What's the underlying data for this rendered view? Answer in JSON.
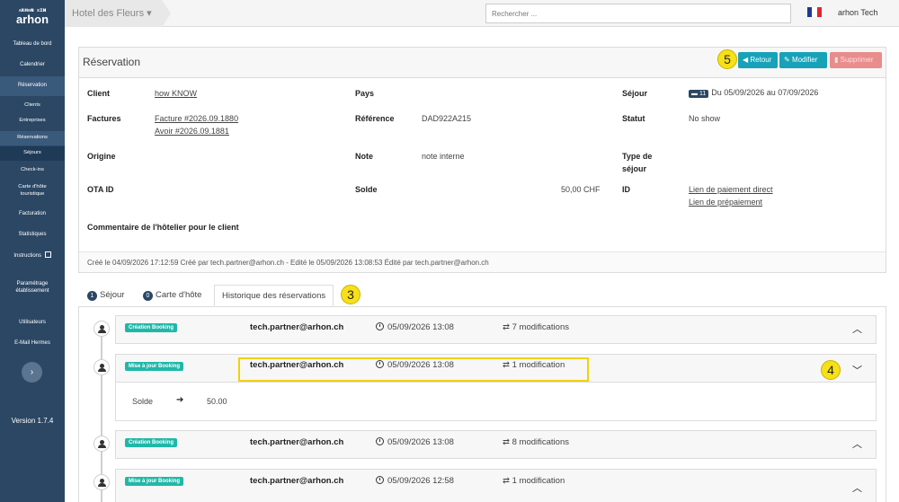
{
  "app": {
    "logo_top": "ᴀʀʜᴏɴ ᴇɪɴ",
    "logo_word": "arhon",
    "version": "Version 1.7.4"
  },
  "sidebar": {
    "items": [
      {
        "label": "Tableau de bord"
      },
      {
        "label": "Calendrier"
      },
      {
        "label": "Réservation"
      },
      {
        "label": "Clients"
      },
      {
        "label": "Entreprises"
      },
      {
        "label": "Réservations"
      },
      {
        "label": "Séjours"
      },
      {
        "label": "Check-ins"
      },
      {
        "label": "Carte d'hôte touristique"
      },
      {
        "label": "Facturation"
      },
      {
        "label": "Statistiques"
      },
      {
        "label": "Instructions"
      },
      {
        "label": "Paramétrage établissement"
      },
      {
        "label": "Utilisateurs"
      },
      {
        "label": "E-Mail Hermes"
      }
    ],
    "collapse_icon": "chevron-right-icon"
  },
  "topbar": {
    "hotel": "Hotel des Fleurs",
    "search_placeholder": "Rechercher ...",
    "user": "arhon Tech",
    "flag_colors": [
      "#1d3a8f",
      "#ffffff",
      "#e0262f"
    ]
  },
  "reservation": {
    "title": "Réservation",
    "buttons": {
      "retour": "Retour",
      "modifier": "Modifier",
      "supprimer": "Supprimer"
    },
    "fields": {
      "client_label": "Client",
      "client_value": "how KNOW",
      "factures_label": "Factures",
      "facture_1": "Facture #2026.09.1880",
      "facture_2": "Avoir #2026.09.1881",
      "origine_label": "Origine",
      "ota_label": "OTA ID",
      "pays_label": "Pays",
      "reference_label": "Référence",
      "reference_value": "DAD922A215",
      "note_label": "Note",
      "note_value": "note interne",
      "solde_label": "Solde",
      "solde_value": "50,00 CHF",
      "sejour_label": "Séjour",
      "sejour_nights": "11",
      "sejour_value": "Du 05/09/2026 au 07/09/2026",
      "statut_label": "Statut",
      "statut_value": "No show",
      "type_label_1": "Type de",
      "type_label_2": "séjour",
      "id_label": "ID",
      "id_link_1": "Lien de paiement direct",
      "id_link_2": "Lien de prépaiement",
      "commentaire_label": "Commentaire de l'hôtelier pour le client"
    },
    "footer": "Créé le 04/09/2026 17:12:59 Créé par tech.partner@arhon.ch - Edité le 05/09/2026 13:08:53 Édité par tech.partner@arhon.ch"
  },
  "tabs": [
    {
      "num": "1",
      "label": "Séjour"
    },
    {
      "num": "0",
      "label": "Carte d'hôte"
    },
    {
      "num": "",
      "label": "Historique des réservations"
    }
  ],
  "history": [
    {
      "badge": "Création Booking",
      "who": "tech.partner@arhon.ch",
      "when": "05/09/2026 13:08",
      "mods": "7 modifications",
      "expanded": false
    },
    {
      "badge": "Mise à jour Booking",
      "who": "tech.partner@arhon.ch",
      "when": "05/09/2026 13:08",
      "mods": "1 modification",
      "expanded": true,
      "detail": {
        "field": "Solde",
        "new_value": "50.00"
      }
    },
    {
      "badge": "Création Booking",
      "who": "tech.partner@arhon.ch",
      "when": "05/09/2026 13:08",
      "mods": "8 modifications",
      "expanded": false
    },
    {
      "badge": "Mise à jour Booking",
      "who": "tech.partner@arhon.ch",
      "when": "05/09/2026 12:58",
      "mods": "1 modification",
      "expanded": false
    }
  ],
  "callouts": {
    "c3": "3",
    "c4": "4",
    "c5": "5"
  }
}
